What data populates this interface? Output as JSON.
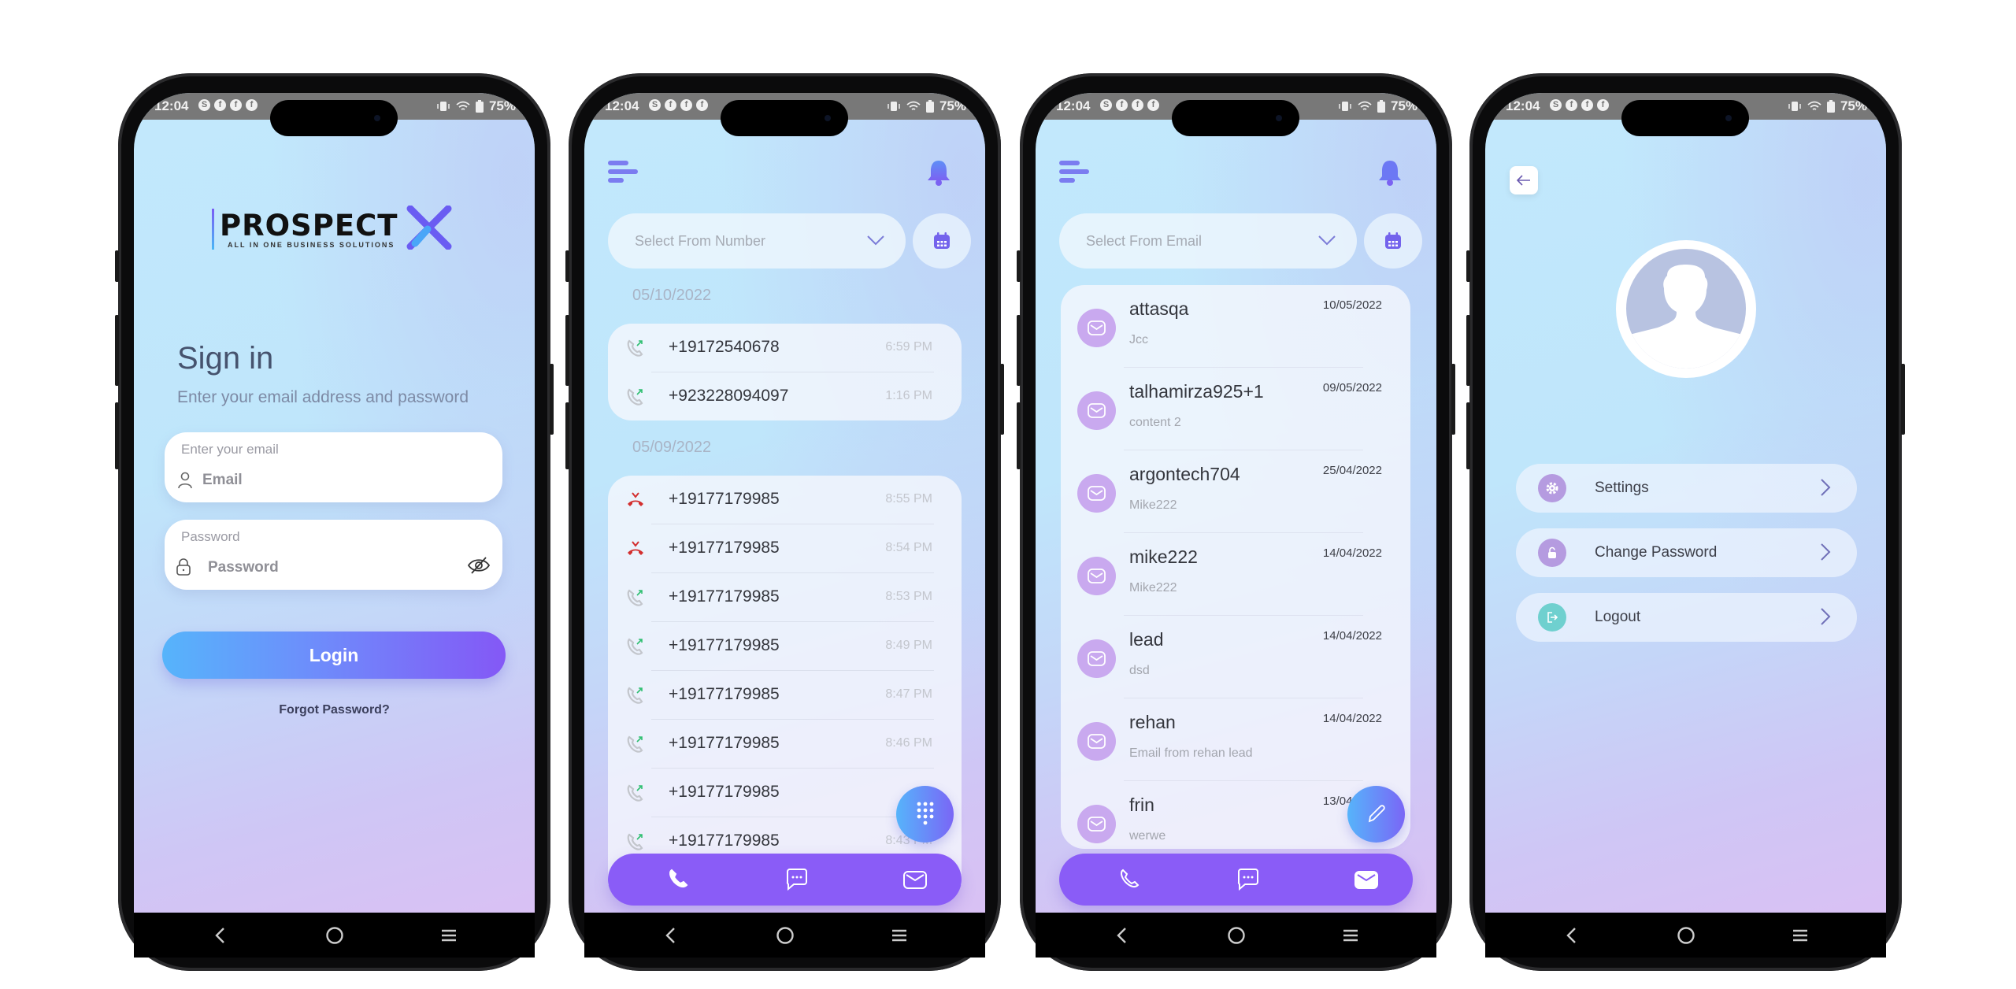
{
  "status": {
    "time": "12:04",
    "battery": "75%"
  },
  "colors": {
    "accent": "#8a5cf7",
    "gradient_start": "#56b4fb",
    "missed": "#d32f2f",
    "outgoing_arrow": "#2fbf71"
  },
  "login": {
    "logo": {
      "brand": "PROSPECTX",
      "tagline": "ALL IN ONE BUSINESS SOLUTIONS"
    },
    "title": "Sign in",
    "subtitle": "Enter your email address and password",
    "email_label": "Enter your email",
    "email_placeholder": "Email",
    "password_label": "Password",
    "password_placeholder": "Password",
    "login_button": "Login",
    "forgot_link": "Forgot Password?"
  },
  "calls": {
    "select_placeholder": "Select From Number",
    "groups": [
      {
        "date": "05/10/2022",
        "items": [
          {
            "number": "+19172540678",
            "time": "6:59 PM",
            "type": "outgoing"
          },
          {
            "number": "+923228094097",
            "time": "1:16 PM",
            "type": "outgoing"
          }
        ]
      },
      {
        "date": "05/09/2022",
        "items": [
          {
            "number": "+19177179985",
            "time": "8:55 PM",
            "type": "missed"
          },
          {
            "number": "+19177179985",
            "time": "8:54 PM",
            "type": "missed"
          },
          {
            "number": "+19177179985",
            "time": "8:53 PM",
            "type": "outgoing"
          },
          {
            "number": "+19177179985",
            "time": "8:49 PM",
            "type": "outgoing"
          },
          {
            "number": "+19177179985",
            "time": "8:47 PM",
            "type": "outgoing"
          },
          {
            "number": "+19177179985",
            "time": "8:46 PM",
            "type": "outgoing"
          },
          {
            "number": "+19177179985",
            "time": "8:4",
            "type": "outgoing"
          },
          {
            "number": "+19177179985",
            "time": "8:43 PM",
            "type": "outgoing"
          }
        ]
      }
    ]
  },
  "emails": {
    "select_placeholder": "Select From Email",
    "items": [
      {
        "name": "attasqa",
        "preview": "Jcc",
        "date": "10/05/2022"
      },
      {
        "name": "talhamirza925+1",
        "preview": "content 2",
        "date": "09/05/2022"
      },
      {
        "name": "argontech704",
        "preview": "Mike222",
        "date": "25/04/2022"
      },
      {
        "name": "mike222",
        "preview": "Mike222",
        "date": "14/04/2022"
      },
      {
        "name": "lead",
        "preview": "dsd",
        "date": "14/04/2022"
      },
      {
        "name": "rehan",
        "preview": "Email from rehan lead",
        "date": "14/04/2022"
      },
      {
        "name": "frin",
        "preview": "werwe",
        "date": "13/04/2022"
      }
    ]
  },
  "profile": {
    "menu": [
      {
        "label": "Settings",
        "icon": "gear-icon",
        "color": "#b59be0"
      },
      {
        "label": "Change Password",
        "icon": "lock-icon",
        "color": "#b59be0"
      },
      {
        "label": "Logout",
        "icon": "logout-icon",
        "color": "#6fd0cf"
      }
    ]
  },
  "tabs": [
    {
      "icon": "phone-icon"
    },
    {
      "icon": "chat-icon"
    },
    {
      "icon": "mail-icon"
    }
  ]
}
